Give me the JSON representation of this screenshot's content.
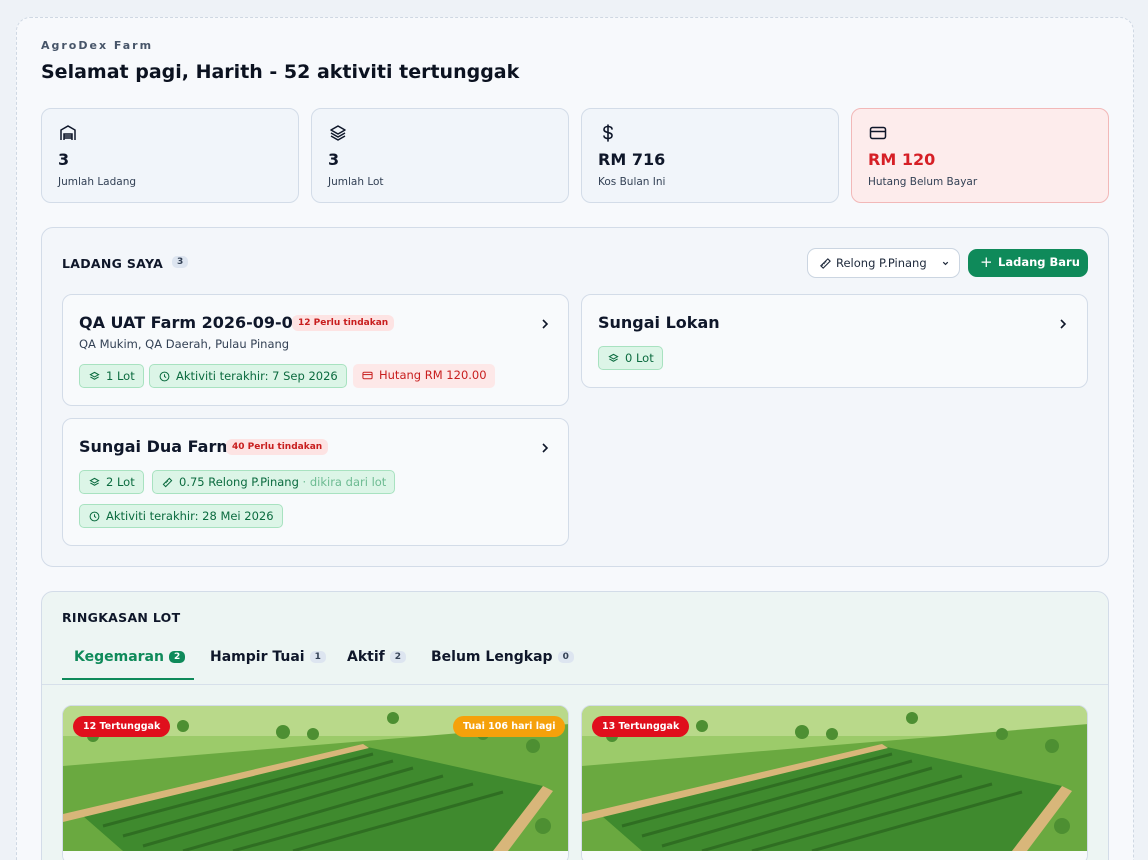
{
  "brand": "AgroDex Farm",
  "greeting": "Selamat pagi, Harith - 52 aktiviti tertunggak",
  "stats": [
    {
      "value": "3",
      "label": "Jumlah Ladang",
      "icon": "warehouse-icon"
    },
    {
      "value": "3",
      "label": "Jumlah Lot",
      "icon": "layers-icon"
    },
    {
      "value": "RM 716",
      "label": "Kos Bulan Ini",
      "icon": "dollar-icon"
    },
    {
      "value": "RM 120",
      "label": "Hutang Belum Bayar",
      "icon": "card-icon",
      "accent": "#d61f26"
    }
  ],
  "farms_section": {
    "title": "LADANG SAYA",
    "count": "3",
    "unit_filter": "Relong P.Pinang",
    "new_button": "Ladang Baru"
  },
  "farms": [
    {
      "name": "QA UAT Farm 2026-09-07",
      "alert": "12 Perlu tindakan",
      "location": "QA Mukim, QA Daerah, Pulau Pinang",
      "chips": [
        "1 Lot",
        "Aktiviti terakhir: 7 Sep 2026",
        "Hutang RM 120.00"
      ]
    },
    {
      "name": "Sungai Lokan",
      "chips": [
        "0 Lot"
      ]
    },
    {
      "name": "Sungai Dua Farm",
      "alert": "40 Perlu tindakan",
      "chips": [
        "2 Lot",
        "0.75 Relong P.Pinang",
        "· dikira dari lot",
        "Aktiviti terakhir: 28 Mei 2026"
      ]
    }
  ],
  "lots_section": {
    "title": "RINGKASAN LOT",
    "tabs": [
      {
        "label": "Kegemaran",
        "count": "2"
      },
      {
        "label": "Hampir Tuai",
        "count": "1"
      },
      {
        "label": "Aktif",
        "count": "2"
      },
      {
        "label": "Belum Lengkap",
        "count": "0"
      }
    ],
    "lots": [
      {
        "overdue": "12 Tertunggak",
        "harvest": "Tuai 106 hari lagi"
      },
      {
        "overdue": "13 Tertunggak"
      }
    ]
  },
  "colors": {
    "primary": "#0f8a5a",
    "danger": "#d61f26",
    "warning": "#f5a10b"
  }
}
